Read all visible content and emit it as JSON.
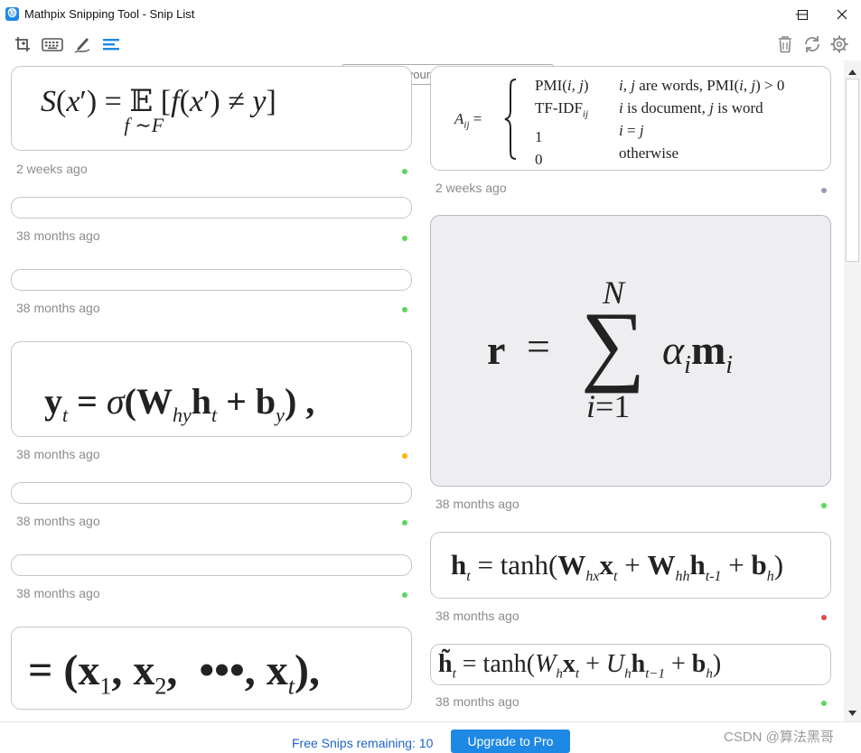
{
  "app": {
    "icon_glyph": "⓾",
    "title": "Mathpix Snipping Tool - Snip List"
  },
  "window": {
    "minimize_glyph": "—",
    "maximize_glyph": "☐",
    "close_glyph": "✕"
  },
  "toolbar": {
    "icons": [
      "screenshot-crop-icon",
      "keyboard-icon",
      "pen-icon",
      "snip-list-icon",
      "trash-icon",
      "sync-icon",
      "gear-icon"
    ],
    "accent": "#1e88e5"
  },
  "search": {
    "placeholder": "Search your Snips..."
  },
  "snips": {
    "left": [
      {
        "time": "2 weeks ago",
        "status": "#5cd65c"
      },
      {
        "time": "38 months ago",
        "status": "#5cd65c"
      },
      {
        "time": "38 months ago",
        "status": "#5cd65c"
      },
      {
        "time": "38 months ago",
        "status": "#f5b800"
      },
      {
        "time": "38 months ago",
        "status": "#5cd65c"
      },
      {
        "time": "38 months ago",
        "status": "#5cd65c"
      }
    ],
    "right": [
      {
        "time": "2 weeks ago",
        "status": "#9a9ab2"
      },
      {
        "time": "38 months ago",
        "status": "#5cd65c"
      },
      {
        "time": "38 months ago",
        "status": "#e24b4b"
      },
      {
        "time": "38 months ago",
        "status": "#5cd65c"
      }
    ]
  },
  "footer": {
    "free_snips": "Free Snips remaining: 10",
    "upgrade_label": "Upgrade to Pro"
  },
  "watermark": "CSDN @算法黑哥",
  "colors": {
    "status_green": "#5cd65c",
    "status_yellow": "#f5b800",
    "status_red": "#e24b4b",
    "status_grey": "#9a9ab2",
    "selected_card_bg": "#eeeef1"
  }
}
